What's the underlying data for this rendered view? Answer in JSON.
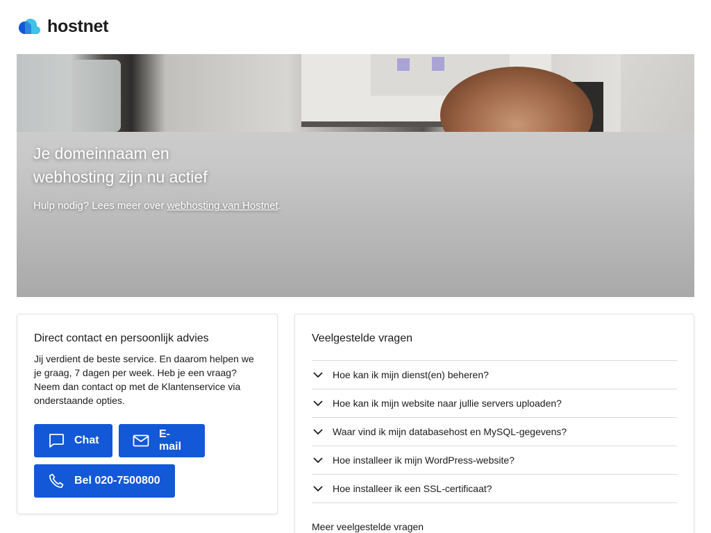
{
  "brand": {
    "name": "hostnet",
    "logo_colors": [
      "#1358d6",
      "#3fc1e8"
    ]
  },
  "hero": {
    "title_line1": "Je domeinnaam en",
    "title_line2": "webhosting zijn nu actief",
    "sub_prefix": "Hulp nodig? Lees meer over ",
    "sub_link": "webhosting van Hostnet",
    "sub_suffix": "."
  },
  "contact": {
    "title": "Direct contact en persoonlijk advies",
    "body": "Jij verdient de beste service. En daarom helpen we je graag, 7 dagen per week. Heb je een vraag? Neem dan contact op met de Klantenservice via onderstaande opties.",
    "buttons": {
      "chat": {
        "label": "Chat",
        "icon": "chat-bubble-icon"
      },
      "email": {
        "label": "E-mail",
        "icon": "envelope-icon"
      },
      "call": {
        "label": "Bel 020-7500800",
        "icon": "phone-icon"
      }
    },
    "button_color": "#1358d6"
  },
  "faq": {
    "title": "Veelgestelde vragen",
    "items": [
      {
        "label": "Hoe kan ik mijn dienst(en) beheren?"
      },
      {
        "label": "Hoe kan ik mijn website naar jullie servers uploaden?"
      },
      {
        "label": "Waar vind ik mijn databasehost en MySQL-gegevens?"
      },
      {
        "label": "Hoe installeer ik mijn WordPress-website?"
      },
      {
        "label": "Hoe installeer ik een SSL-certificaat?"
      }
    ],
    "more_link": "Meer veelgestelde vragen"
  }
}
